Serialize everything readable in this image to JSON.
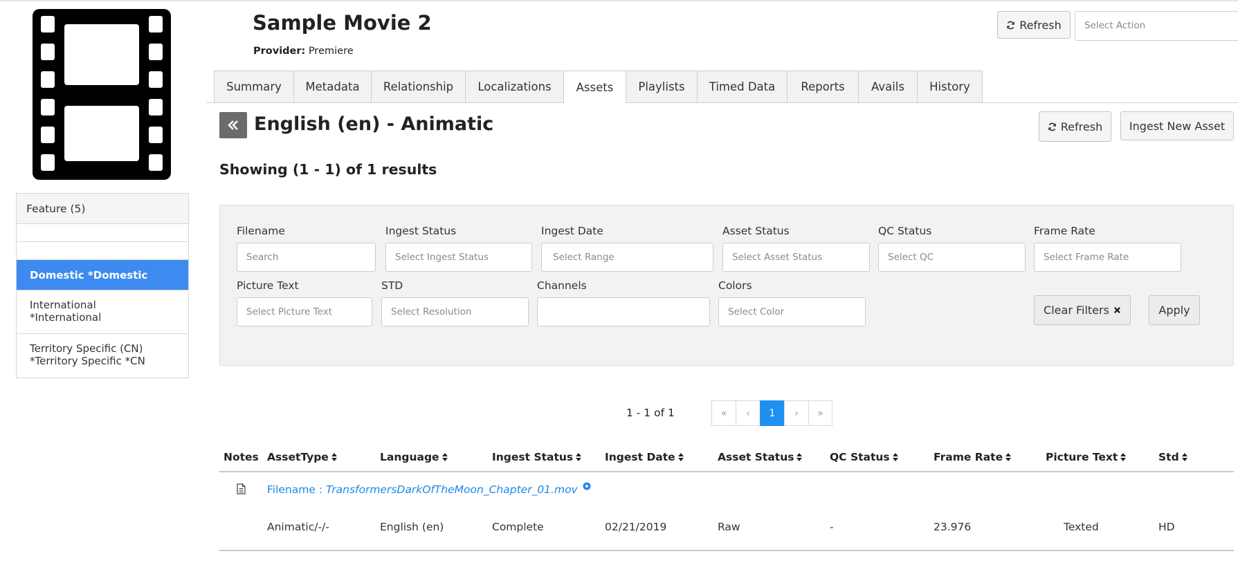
{
  "header": {
    "title": "Sample Movie 2",
    "provider_label": "Provider:",
    "provider_value": "Premiere",
    "refresh_label": "Refresh",
    "action_placeholder": "Select Action"
  },
  "sidebar": {
    "items": [
      {
        "label": "Feature (5)"
      },
      {
        "label": ""
      },
      {
        "label": ""
      },
      {
        "label": "Domestic *Domestic",
        "active": true
      },
      {
        "line1": "International",
        "line2": "*International"
      },
      {
        "line1": "Territory Specific (CN)",
        "line2": "*Territory Specific *CN"
      }
    ]
  },
  "tabs": [
    {
      "label": "Summary"
    },
    {
      "label": "Metadata"
    },
    {
      "label": "Relationship"
    },
    {
      "label": "Localizations"
    },
    {
      "label": "Assets",
      "active": true
    },
    {
      "label": "Playlists"
    },
    {
      "label": "Timed Data"
    },
    {
      "label": "Reports"
    },
    {
      "label": "Avails"
    },
    {
      "label": "History"
    }
  ],
  "section": {
    "title": "English (en) - Animatic",
    "refresh_label": "Refresh",
    "ingest_label": "Ingest New Asset",
    "showing": "Showing (1 - 1) of 1 results"
  },
  "filters": {
    "filename": {
      "label": "Filename",
      "placeholder": "Search"
    },
    "ingest_status": {
      "label": "Ingest Status",
      "placeholder": "Select Ingest Status"
    },
    "ingest_date": {
      "label": "Ingest Date",
      "placeholder": "Select Range"
    },
    "asset_status": {
      "label": "Asset Status",
      "placeholder": "Select Asset Status"
    },
    "qc_status": {
      "label": "QC Status",
      "placeholder": "Select QC"
    },
    "frame_rate": {
      "label": "Frame Rate",
      "placeholder": "Select Frame Rate"
    },
    "picture_text": {
      "label": "Picture Text",
      "placeholder": "Select Picture Text"
    },
    "std": {
      "label": "STD",
      "placeholder": "Select Resolution"
    },
    "channels": {
      "label": "Channels",
      "placeholder": ""
    },
    "colors": {
      "label": "Colors",
      "placeholder": "Select Color"
    },
    "clear_label": "Clear Filters",
    "apply_label": "Apply"
  },
  "pagination": {
    "info": "1 - 1 of 1",
    "first": "«",
    "prev": "‹",
    "current": "1",
    "next": "›",
    "last": "»"
  },
  "table": {
    "headers": {
      "notes": "Notes",
      "asset_type": "AssetType",
      "language": "Language",
      "ingest_status": "Ingest Status",
      "ingest_date": "Ingest Date",
      "asset_status": "Asset Status",
      "qc_status": "QC Status",
      "frame_rate": "Frame Rate",
      "picture_text": "Picture Text",
      "std": "Std"
    },
    "row": {
      "filename_prefix": "Filename : ",
      "filename": "TransformersDarkOfTheMoon_Chapter_01.mov",
      "asset_type": "Animatic/-/-",
      "language": "English (en)",
      "ingest_status": "Complete",
      "ingest_date": "02/21/2019",
      "asset_status": "Raw",
      "qc_status": "-",
      "frame_rate": "23.976",
      "picture_text": "Texted",
      "std": "HD"
    }
  },
  "colors": {
    "accent": "#3d8bf0",
    "link": "#1e88e5",
    "page_active": "#1e90f0"
  }
}
